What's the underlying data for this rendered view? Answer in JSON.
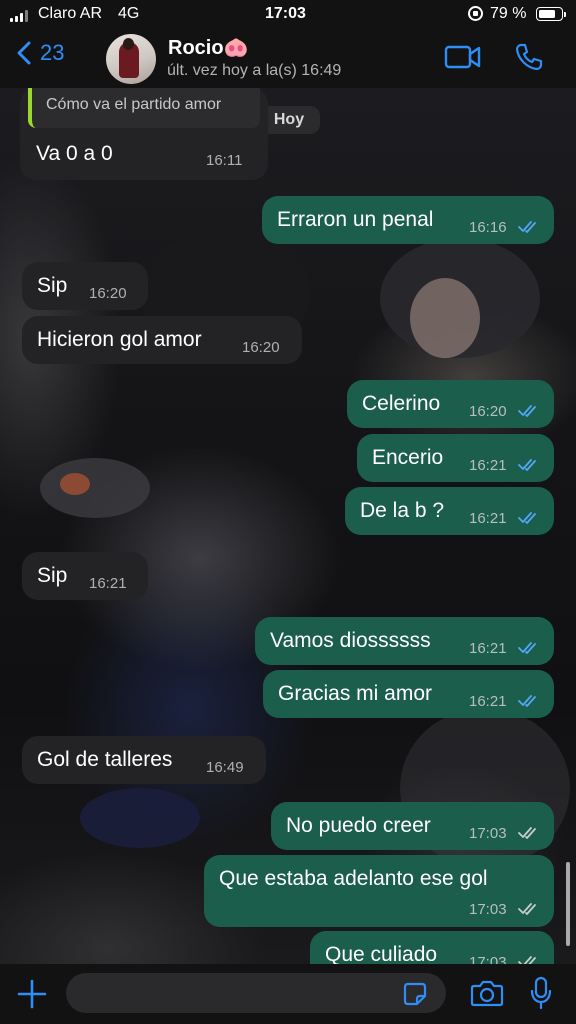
{
  "status_bar": {
    "carrier": "Claro AR",
    "network": "4G",
    "time": "17:03",
    "battery_percent": "79 %",
    "battery_level": 0.79
  },
  "header": {
    "back_count": "23",
    "contact_name": "Rocio🐽",
    "contact_status": "últ. vez hoy a la(s) 16:49",
    "accent_color": "#2f8ef5"
  },
  "date_divider": "Hoy",
  "messages": [
    {
      "direction": "in",
      "quoted": "Cómo va el partido amor",
      "text": "Va 0 a 0",
      "time": "16:11"
    },
    {
      "direction": "out",
      "text": "Erraron un penal",
      "time": "16:16",
      "status": "read"
    },
    {
      "direction": "in",
      "text": "Sip",
      "time": "16:20"
    },
    {
      "direction": "in",
      "text": "Hicieron gol amor",
      "time": "16:20"
    },
    {
      "direction": "out",
      "text": "Celerino",
      "time": "16:20",
      "status": "read"
    },
    {
      "direction": "out",
      "text": "Encerio",
      "time": "16:21",
      "status": "read"
    },
    {
      "direction": "out",
      "text": "De la b ?",
      "time": "16:21",
      "status": "read"
    },
    {
      "direction": "in",
      "text": "Sip",
      "time": "16:21"
    },
    {
      "direction": "out",
      "text": "Vamos diossssss",
      "time": "16:21",
      "status": "read"
    },
    {
      "direction": "out",
      "text": "Gracias mi amor",
      "time": "16:21",
      "status": "read"
    },
    {
      "direction": "in",
      "text": "Gol de talleres",
      "time": "16:49"
    },
    {
      "direction": "out",
      "text": "No puedo creer",
      "time": "17:03",
      "status": "delivered"
    },
    {
      "direction": "out",
      "text": "Que estaba adelanto ese gol",
      "time": "17:03",
      "status": "delivered"
    },
    {
      "direction": "out",
      "text": "Que culiado",
      "time": "17:03",
      "status": "delivered"
    }
  ],
  "input": {
    "placeholder": ""
  },
  "colors": {
    "incoming_bubble": "#232325",
    "outgoing_bubble": "#1b5e4b",
    "read_ticks": "#53a6f7",
    "delivered_ticks": "#c8cdcb",
    "quote_bar": "#9ad82e"
  },
  "icons": [
    "back-chevron-icon",
    "video-call-icon",
    "phone-icon",
    "plus-icon",
    "sticker-icon",
    "camera-icon",
    "microphone-icon"
  ]
}
